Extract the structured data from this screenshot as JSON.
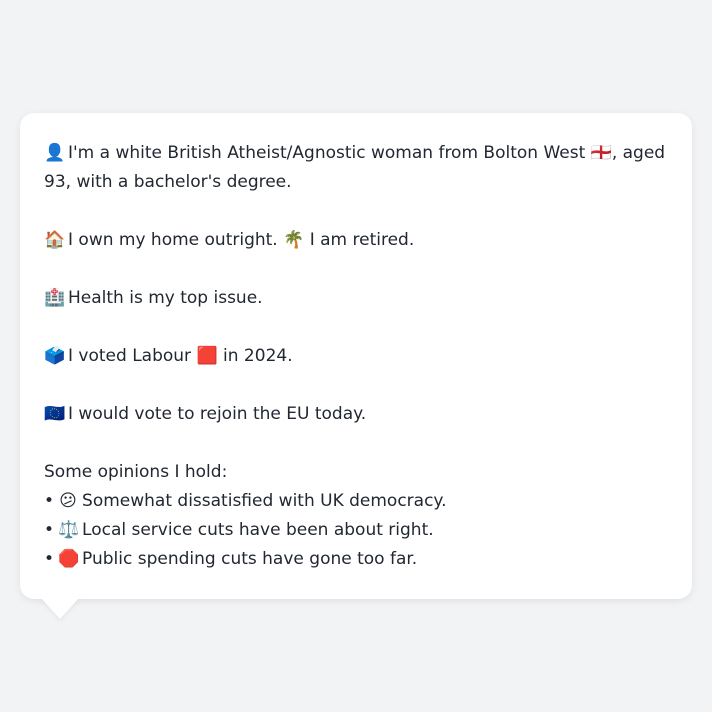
{
  "persona": {
    "intro": {
      "icon": "👤",
      "text_before_flag": "I'm a white British Atheist/Agnostic woman from Bolton West",
      "flag": "🏴󠁧󠁢󠁥󠁮󠁧󠁿",
      "text_after_flag": ", aged 93, with a bachelor's degree."
    },
    "housing": {
      "icon": "🏠",
      "text": "I own my home outright.",
      "icon2": "🌴",
      "text2": "I am retired."
    },
    "issue": {
      "icon": "🏥",
      "text": "Health is my top issue."
    },
    "vote": {
      "icon": "🗳️",
      "text_before": "I voted Labour",
      "party_icon": "🟥",
      "text_after": "in 2024."
    },
    "eu": {
      "icon": "🇪🇺",
      "text": "I would vote to rejoin the EU today."
    },
    "opinions": {
      "heading": "Some opinions I hold:",
      "bullet": "•",
      "items": [
        {
          "icon": "😕",
          "text": "Somewhat dissatisfied with UK democracy."
        },
        {
          "icon": "⚖️",
          "text": "Local service cuts have been about right."
        },
        {
          "icon": "🛑",
          "text": "Public spending cuts have gone too far."
        }
      ]
    }
  }
}
